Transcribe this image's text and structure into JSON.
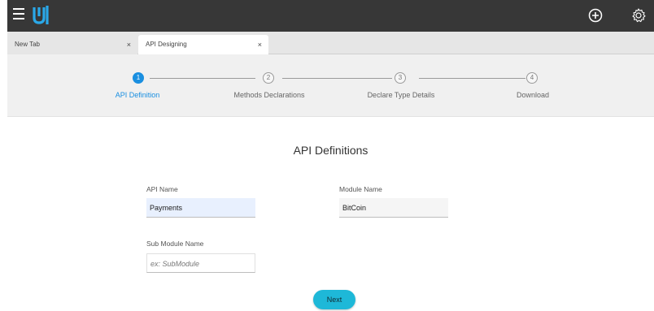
{
  "tabs": [
    {
      "label": "New Tab",
      "active": false
    },
    {
      "label": "API Designing",
      "active": true
    }
  ],
  "tab_close_glyph": "×",
  "stepper": {
    "steps": [
      {
        "number": "1",
        "label": "API Definition",
        "active": true
      },
      {
        "number": "2",
        "label": "Methods Declarations",
        "active": false
      },
      {
        "number": "3",
        "label": "Declare Type Details",
        "active": false
      },
      {
        "number": "4",
        "label": "Download",
        "active": false
      }
    ]
  },
  "form": {
    "title": "API Definitions",
    "api_name": {
      "label": "API Name",
      "value": "Payments"
    },
    "module_name": {
      "label": "Module Name",
      "value": "BitCoin"
    },
    "sub_module_name": {
      "label": "Sub Module Name",
      "placeholder": "ex: SubModule"
    },
    "next_label": "Next"
  },
  "icons": {
    "menu": "hamburger-menu-icon",
    "logo": "app-logo-icon",
    "add": "add-circle-icon",
    "settings": "gear-icon"
  },
  "colors": {
    "topbar": "#373737",
    "accent_blue": "#1a8fe0",
    "next_button": "#1eb8d8",
    "filled_field": "#e8f0fe"
  }
}
